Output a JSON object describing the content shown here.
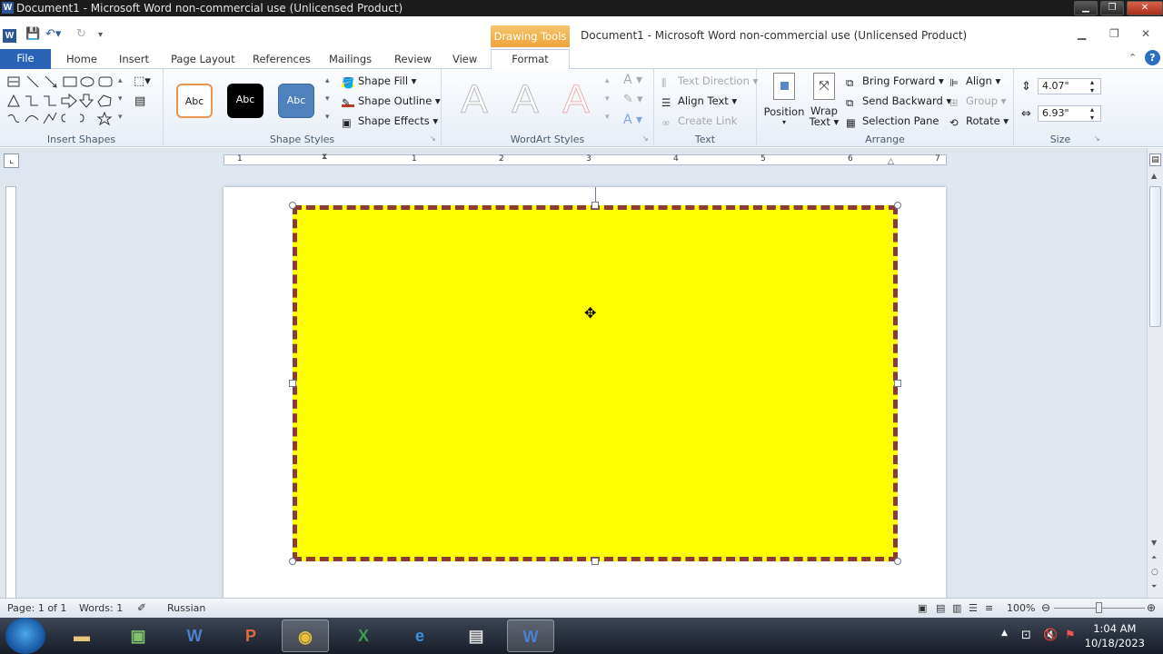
{
  "window": {
    "outer_title": "Document1 - Microsoft Word non-commercial use (Unlicensed Product)",
    "app_title": "Document1  -  Microsoft Word non-commercial use (Unlicensed Product)",
    "contextual_tab_group": "Drawing Tools"
  },
  "tabs": [
    "File",
    "Home",
    "Insert",
    "Page Layout",
    "References",
    "Mailings",
    "Review",
    "View",
    "Format"
  ],
  "ribbon": {
    "insert_shapes": {
      "label": "Insert Shapes"
    },
    "shape_styles": {
      "label": "Shape Styles",
      "presets": [
        "Abc",
        "Abc",
        "Abc"
      ],
      "shape_fill": "Shape Fill",
      "shape_outline": "Shape Outline",
      "shape_effects": "Shape Effects"
    },
    "wordart_styles": {
      "label": "WordArt Styles",
      "glyph": "A"
    },
    "text": {
      "label": "Text",
      "text_direction": "Text Direction",
      "align_text": "Align Text",
      "create_link": "Create Link"
    },
    "arrange": {
      "label": "Arrange",
      "position": "Position",
      "wrap_text_1": "Wrap",
      "wrap_text_2": "Text",
      "bring_forward": "Bring Forward",
      "send_backward": "Send Backward",
      "selection_pane": "Selection Pane",
      "align": "Align",
      "group": "Group",
      "rotate": "Rotate"
    },
    "size": {
      "label": "Size",
      "height": "4.07\"",
      "width": "6.93\""
    }
  },
  "ruler": {
    "numbers": [
      "1",
      "1",
      "2",
      "3",
      "4",
      "5",
      "6",
      "7"
    ]
  },
  "status": {
    "page": "Page: 1 of 1",
    "words": "Words: 1",
    "language": "Russian",
    "zoom": "100%"
  },
  "taskbar": {
    "time": "1:04 AM",
    "date": "10/18/2023"
  },
  "colors": {
    "shape_fill": "#ffff00",
    "shape_outline": "#8b3a3a",
    "file_tab": "#2a63b6",
    "drawing_tools": "#f0a63f"
  }
}
